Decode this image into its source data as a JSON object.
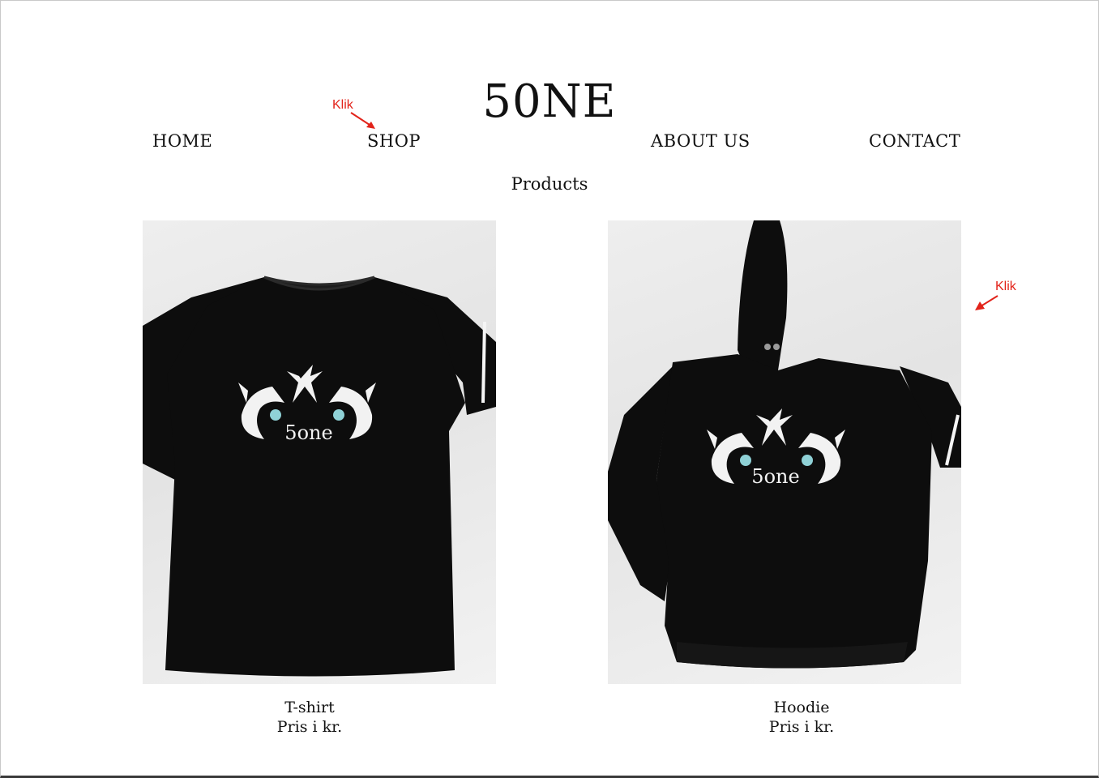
{
  "header": {
    "logo": "50NE"
  },
  "nav": {
    "items": [
      {
        "label": "HOME"
      },
      {
        "label": "SHOP"
      },
      {
        "label": "ABOUT US"
      },
      {
        "label": "CONTACT"
      }
    ]
  },
  "annotations": {
    "shop_note": "Klik",
    "hoodie_note": "Klik",
    "color": "#e2231a"
  },
  "main": {
    "section_title": "Products",
    "products": [
      {
        "name": "T-shirt",
        "price_label": "Pris i kr.",
        "print_text": "5one",
        "garment_color": "#0d0d0d"
      },
      {
        "name": "Hoodie",
        "price_label": "Pris i kr.",
        "print_text": "5one",
        "garment_color": "#0d0d0d"
      }
    ]
  },
  "icons": {
    "annotation_arrow": "arrow-icon"
  }
}
